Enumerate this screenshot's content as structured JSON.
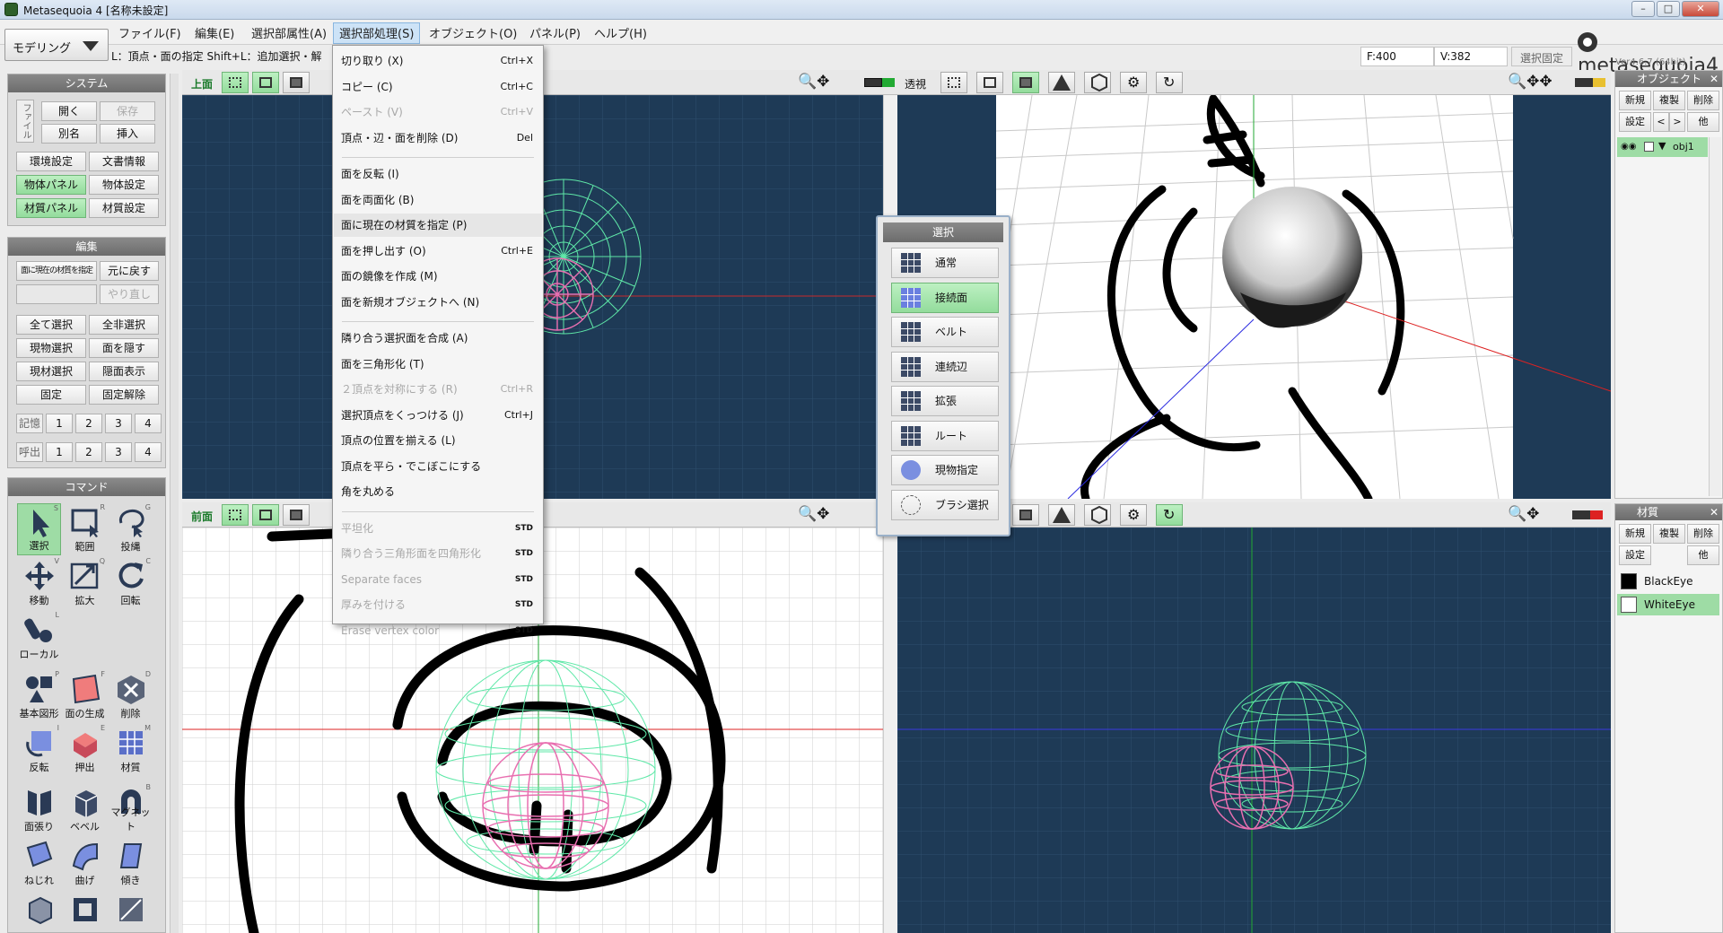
{
  "window": {
    "title": "Metasequoia 4 [名称未設定]"
  },
  "menubar": [
    "ファイル(F)",
    "編集(E)",
    "選択部属性(A)",
    "選択部処理(S)",
    "オブジェクト(O)",
    "パネル(P)",
    "ヘルプ(H)"
  ],
  "mode": "モデリング",
  "hint": "L：頂点・面の指定  Shift+L：追加選択・解",
  "status": {
    "faces": "F:400",
    "vertices": "V:382",
    "lock": "選択固定"
  },
  "logo": "metasequoia4",
  "version": "Ver4.6.7 (64bit)",
  "system_panel": {
    "title": "システム",
    "file_tab": "ファイル",
    "buttons": [
      "開く",
      "保存",
      "別名",
      "挿入"
    ],
    "settings": [
      "環境設定",
      "文書情報",
      "物体パネル",
      "物体設定",
      "材質パネル",
      "材質設定"
    ]
  },
  "edit_panel": {
    "title": "編集",
    "buttons": [
      "面に現在の材質を指定",
      "元に戻す",
      "",
      "やり直し",
      "全て選択",
      "全非選択",
      "現物選択",
      "面を隠す",
      "現材選択",
      "隠面表示",
      "固定",
      "固定解除"
    ],
    "memory": "記憶",
    "recall": "呼出",
    "slots": [
      "1",
      "2",
      "3",
      "4"
    ]
  },
  "command_panel": {
    "title": "コマンド",
    "tools": [
      {
        "label": "選択",
        "key": "S"
      },
      {
        "label": "範囲",
        "key": "R"
      },
      {
        "label": "投縄",
        "key": "G"
      },
      {
        "label": "移動",
        "key": "V"
      },
      {
        "label": "拡大",
        "key": "Q"
      },
      {
        "label": "回転",
        "key": "C"
      },
      {
        "label": "ローカル",
        "key": "L"
      },
      {
        "label": "基本図形",
        "key": "P"
      },
      {
        "label": "面の生成",
        "key": "F"
      },
      {
        "label": "削除",
        "key": "D"
      },
      {
        "label": "反転",
        "key": "I"
      },
      {
        "label": "押出",
        "key": "E"
      },
      {
        "label": "材質",
        "key": "M"
      },
      {
        "label": "面張り",
        "key": ""
      },
      {
        "label": "ベベル",
        "key": ""
      },
      {
        "label": "マグネット",
        "key": "B"
      },
      {
        "label": "ねじれ",
        "key": ""
      },
      {
        "label": "曲げ",
        "key": ""
      },
      {
        "label": "傾き",
        "key": ""
      }
    ]
  },
  "viewports": {
    "top": "上面",
    "persp": "透視",
    "front": "前面"
  },
  "dropdown": {
    "items": [
      {
        "label": "切り取り (X)",
        "shortcut": "Ctrl+X",
        "disabled": false
      },
      {
        "label": "コピー (C)",
        "shortcut": "Ctrl+C",
        "disabled": false
      },
      {
        "label": "ペースト (V)",
        "shortcut": "Ctrl+V",
        "disabled": true
      },
      {
        "label": "頂点・辺・面を削除 (D)",
        "shortcut": "Del",
        "disabled": false
      },
      {
        "sep": true
      },
      {
        "label": "面を反転 (I)",
        "shortcut": "",
        "disabled": false
      },
      {
        "label": "面を両面化 (B)",
        "shortcut": "",
        "disabled": false
      },
      {
        "label": "面に現在の材質を指定 (P)",
        "shortcut": "",
        "disabled": false,
        "hl": true
      },
      {
        "label": "面を押し出す (O)",
        "shortcut": "Ctrl+E",
        "disabled": false
      },
      {
        "label": "面の鏡像を作成 (M)",
        "shortcut": "",
        "disabled": false
      },
      {
        "label": "面を新規オブジェクトへ (N)",
        "shortcut": "",
        "disabled": false
      },
      {
        "sep": true
      },
      {
        "label": "隣り合う選択面を合成 (A)",
        "shortcut": "",
        "disabled": false
      },
      {
        "label": "面を三角形化 (T)",
        "shortcut": "",
        "disabled": false
      },
      {
        "label": "２頂点を対称にする (R)",
        "shortcut": "Ctrl+R",
        "disabled": true
      },
      {
        "label": "選択頂点をくっつける (J)",
        "shortcut": "Ctrl+J",
        "disabled": false
      },
      {
        "label": "頂点の位置を揃える (L)",
        "shortcut": "",
        "disabled": false
      },
      {
        "label": "頂点を平ら・でこぼこにする",
        "shortcut": "",
        "disabled": false
      },
      {
        "label": "角を丸める",
        "shortcut": "",
        "disabled": false
      },
      {
        "sep": true
      },
      {
        "label": "平坦化",
        "shortcut": "STD",
        "disabled": true
      },
      {
        "label": "隣り合う三角形面を四角形化",
        "shortcut": "STD",
        "disabled": true
      },
      {
        "label": "Separate faces",
        "shortcut": "STD",
        "disabled": true
      },
      {
        "label": "厚みを付ける",
        "shortcut": "STD",
        "disabled": true
      },
      {
        "label": "Erase vertex color",
        "shortcut": "STD",
        "disabled": true
      }
    ]
  },
  "select_popup": {
    "title": "選択",
    "options": [
      "通常",
      "接続面",
      "ベルト",
      "連続辺",
      "拡張",
      "ルート",
      "現物指定",
      "ブラシ選択"
    ],
    "active": "接続面"
  },
  "object_panel": {
    "title": "オブジェクト",
    "buttons": [
      "新規",
      "複製",
      "削除",
      "設定",
      "<",
      ">",
      "他"
    ],
    "objects": [
      "obj1"
    ]
  },
  "material_panel": {
    "title": "材質",
    "buttons": [
      "新規",
      "複製",
      "削除",
      "設定",
      "他"
    ],
    "materials": [
      {
        "name": "BlackEye",
        "color": "#000000"
      },
      {
        "name": "WhiteEye",
        "color": "#ffffff"
      }
    ]
  }
}
